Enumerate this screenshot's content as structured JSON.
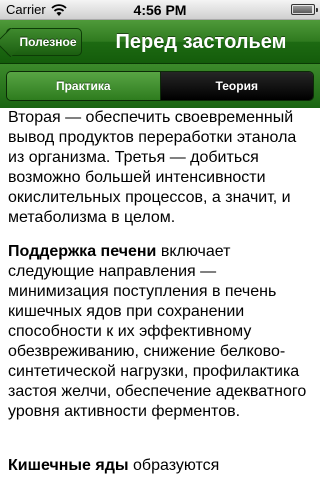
{
  "status": {
    "carrier": "Carrier",
    "time": "4:56 PM"
  },
  "nav": {
    "back_label": "Полезное",
    "title": "Перед застольем"
  },
  "segments": {
    "practice": "Практика",
    "theory": "Теория",
    "selected": "Теория"
  },
  "content": {
    "p1": "Вторая — обеспечить своевременный вывод продуктов переработки этанола из организма. Третья — добиться возможно большей интенсивности окислительных процессов, а значит, и метаболизма в целом.",
    "p2_bold": "Поддержка печени",
    "p2_rest": " включает следующие направления — минимизация поступления в печень кишечных ядов при сохранении способности к их эффективному обезвреживанию, снижение белково-синтетической нагрузки, профилактика застоя желчи, обеспечение адекватного уровня активности ферментов.",
    "p3_bold": "Кишечные яды",
    "p3_rest": " образуются"
  },
  "colors": {
    "nav_green": "#2f7a1f",
    "segment_selected": "#000000"
  }
}
